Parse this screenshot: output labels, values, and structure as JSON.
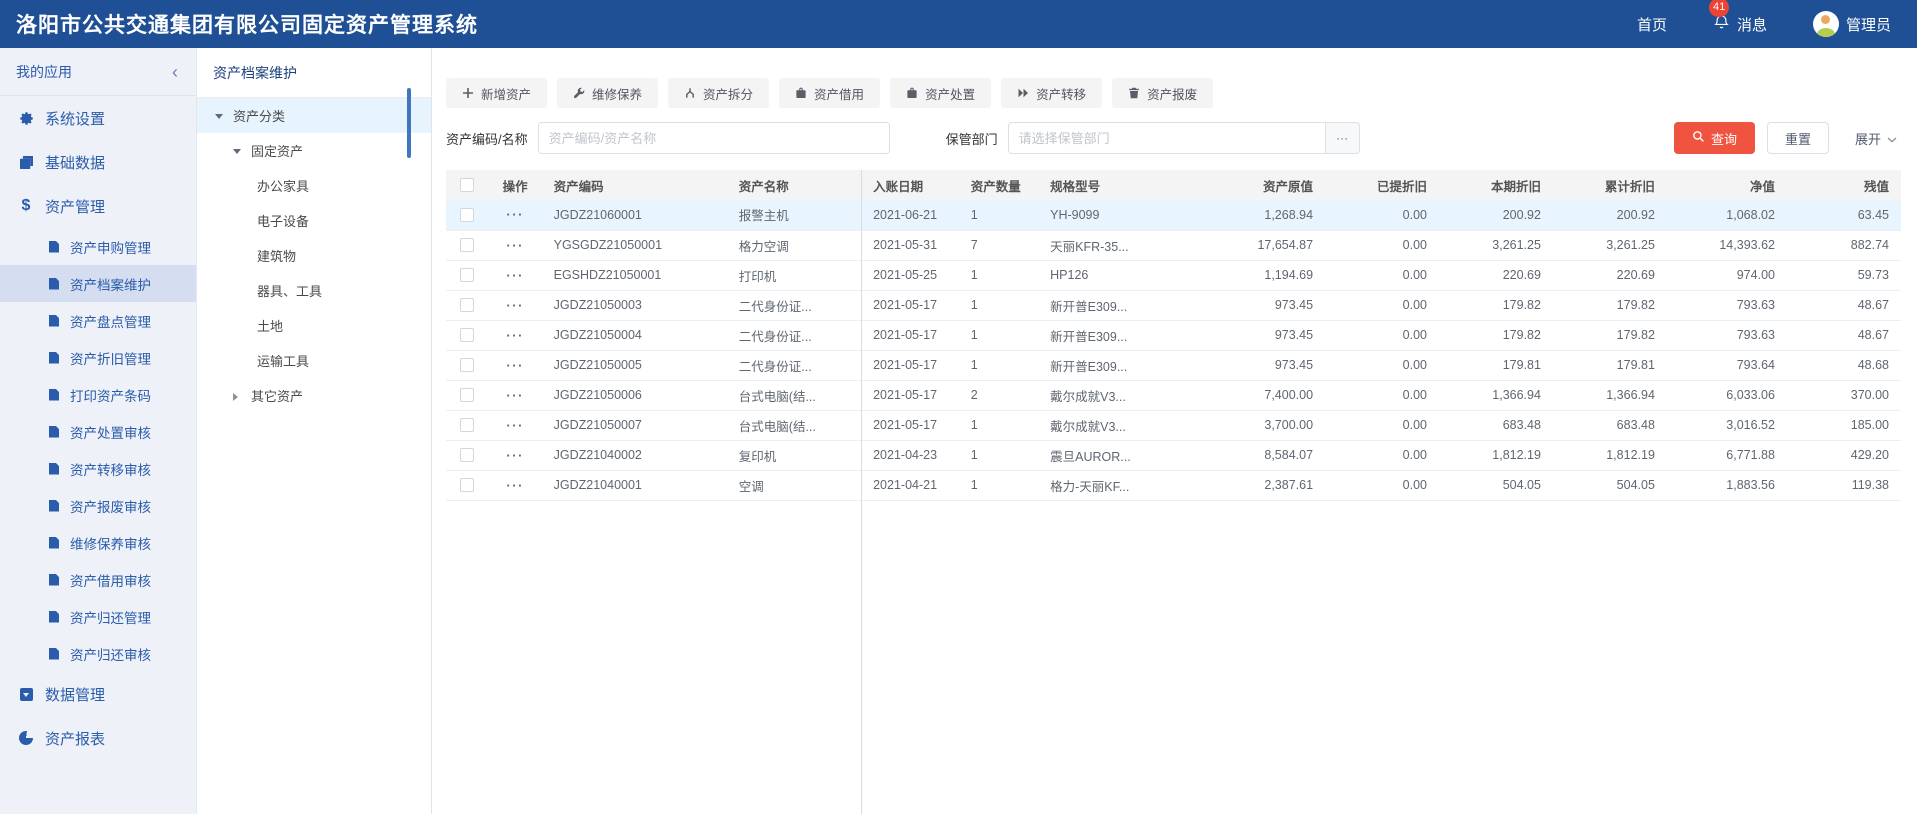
{
  "colors": {
    "topbar_bg": "#1f5096",
    "badge_red": "#ed4334",
    "primary_blue": "#2b5cab",
    "search_button_red": "#f0533f",
    "row_highlight": "#e9f5fe",
    "tree_selected_bg": "#e7f3fd"
  },
  "header": {
    "title": "洛阳市公共交通集团有限公司固定资产管理系统",
    "nav_home": "首页",
    "nav_messages": "消息",
    "message_count": "41",
    "user_name": "管理员"
  },
  "sidebar": {
    "title": "我的应用",
    "collapse_icon": "‹",
    "items": [
      {
        "label": "系统设置",
        "icon": "gear",
        "level": 1
      },
      {
        "label": "基础数据",
        "icon": "book",
        "level": 1
      },
      {
        "label": "资产管理",
        "icon": "dollar",
        "level": 1
      },
      {
        "label": "资产申购管理",
        "icon": "doc",
        "level": 2
      },
      {
        "label": "资产档案维护",
        "icon": "doc",
        "level": 2,
        "active": true
      },
      {
        "label": "资产盘点管理",
        "icon": "doc",
        "level": 2
      },
      {
        "label": "资产折旧管理",
        "icon": "doc",
        "level": 2
      },
      {
        "label": "打印资产条码",
        "icon": "doc",
        "level": 2
      },
      {
        "label": "资产处置审核",
        "icon": "doc",
        "level": 2
      },
      {
        "label": "资产转移审核",
        "icon": "doc",
        "level": 2
      },
      {
        "label": "资产报废审核",
        "icon": "doc",
        "level": 2
      },
      {
        "label": "维修保养审核",
        "icon": "doc",
        "level": 2
      },
      {
        "label": "资产借用审核",
        "icon": "doc",
        "level": 2
      },
      {
        "label": "资产归还管理",
        "icon": "doc",
        "level": 2
      },
      {
        "label": "资产归还审核",
        "icon": "doc",
        "level": 2
      },
      {
        "label": "数据管理",
        "icon": "data",
        "level": 1
      },
      {
        "label": "资产报表",
        "icon": "pie",
        "level": 1
      }
    ]
  },
  "tree_panel": {
    "title": "资产档案维护",
    "nodes": [
      {
        "label": "资产分类",
        "level": 1,
        "caret": "down",
        "selected": true
      },
      {
        "label": "固定资产",
        "level": 2,
        "caret": "down"
      },
      {
        "label": "办公家具",
        "level": 3
      },
      {
        "label": "电子设备",
        "level": 3
      },
      {
        "label": "建筑物",
        "level": 3
      },
      {
        "label": "器具、工具",
        "level": 3
      },
      {
        "label": "土地",
        "level": 3
      },
      {
        "label": "运输工具",
        "level": 3
      },
      {
        "label": "其它资产",
        "level": 2,
        "caret": "right"
      }
    ]
  },
  "toolbar": {
    "buttons": [
      {
        "name": "add-asset",
        "icon": "plus",
        "label": "新增资产"
      },
      {
        "name": "repair-maintain",
        "icon": "wrench",
        "label": "维修保养"
      },
      {
        "name": "split-asset",
        "icon": "split",
        "label": "资产拆分"
      },
      {
        "name": "borrow-asset",
        "icon": "bag",
        "label": "资产借用"
      },
      {
        "name": "dispose-asset",
        "icon": "bag",
        "label": "资产处置"
      },
      {
        "name": "transfer-asset",
        "icon": "transfer",
        "label": "资产转移"
      },
      {
        "name": "scrap-asset",
        "icon": "trash",
        "label": "资产报废"
      }
    ]
  },
  "filters": {
    "code_label": "资产编码/名称",
    "code_placeholder": "资产编码/资产名称",
    "dept_label": "保管部门",
    "dept_placeholder": "请选择保管部门",
    "dept_more": "···",
    "search_label": "查询",
    "reset_label": "重置",
    "expand_label": "展开"
  },
  "table": {
    "more_actions": "···",
    "columns": [
      "操作",
      "资产编码",
      "资产名称",
      "入账日期",
      "资产数量",
      "规格型号",
      "资产原值",
      "已提折旧",
      "本期折旧",
      "累计折旧",
      "净值",
      "残值"
    ],
    "rows": [
      {
        "code": "JGDZ21060001",
        "name": "报警主机",
        "date": "2021-06-21",
        "qty": "1",
        "model": "YH-9099",
        "original": "1,268.94",
        "depreciated": "0.00",
        "current": "200.92",
        "accumulated": "200.92",
        "net": "1,068.02",
        "residual": "63.45",
        "selected": true
      },
      {
        "code": "YGSGDZ21050001",
        "name": "格力空调",
        "date": "2021-05-31",
        "qty": "7",
        "model": "天丽KFR-35...",
        "original": "17,654.87",
        "depreciated": "0.00",
        "current": "3,261.25",
        "accumulated": "3,261.25",
        "net": "14,393.62",
        "residual": "882.74"
      },
      {
        "code": "EGSHDZ21050001",
        "name": "打印机",
        "date": "2021-05-25",
        "qty": "1",
        "model": "HP126",
        "original": "1,194.69",
        "depreciated": "0.00",
        "current": "220.69",
        "accumulated": "220.69",
        "net": "974.00",
        "residual": "59.73"
      },
      {
        "code": "JGDZ21050003",
        "name": "二代身份证...",
        "date": "2021-05-17",
        "qty": "1",
        "model": "新开普E309...",
        "original": "973.45",
        "depreciated": "0.00",
        "current": "179.82",
        "accumulated": "179.82",
        "net": "793.63",
        "residual": "48.67"
      },
      {
        "code": "JGDZ21050004",
        "name": "二代身份证...",
        "date": "2021-05-17",
        "qty": "1",
        "model": "新开普E309...",
        "original": "973.45",
        "depreciated": "0.00",
        "current": "179.82",
        "accumulated": "179.82",
        "net": "793.63",
        "residual": "48.67"
      },
      {
        "code": "JGDZ21050005",
        "name": "二代身份证...",
        "date": "2021-05-17",
        "qty": "1",
        "model": "新开普E309...",
        "original": "973.45",
        "depreciated": "0.00",
        "current": "179.81",
        "accumulated": "179.81",
        "net": "793.64",
        "residual": "48.68"
      },
      {
        "code": "JGDZ21050006",
        "name": "台式电脑(结...",
        "date": "2021-05-17",
        "qty": "2",
        "model": "戴尔成就V3...",
        "original": "7,400.00",
        "depreciated": "0.00",
        "current": "1,366.94",
        "accumulated": "1,366.94",
        "net": "6,033.06",
        "residual": "370.00"
      },
      {
        "code": "JGDZ21050007",
        "name": "台式电脑(结...",
        "date": "2021-05-17",
        "qty": "1",
        "model": "戴尔成就V3...",
        "original": "3,700.00",
        "depreciated": "0.00",
        "current": "683.48",
        "accumulated": "683.48",
        "net": "3,016.52",
        "residual": "185.00"
      },
      {
        "code": "JGDZ21040002",
        "name": "复印机",
        "date": "2021-04-23",
        "qty": "1",
        "model": "震旦AUROR...",
        "original": "8,584.07",
        "depreciated": "0.00",
        "current": "1,812.19",
        "accumulated": "1,812.19",
        "net": "6,771.88",
        "residual": "429.20"
      },
      {
        "code": "JGDZ21040001",
        "name": "空调",
        "date": "2021-04-21",
        "qty": "1",
        "model": "格力-天丽KF...",
        "original": "2,387.61",
        "depreciated": "0.00",
        "current": "504.05",
        "accumulated": "504.05",
        "net": "1,883.56",
        "residual": "119.38"
      }
    ]
  }
}
